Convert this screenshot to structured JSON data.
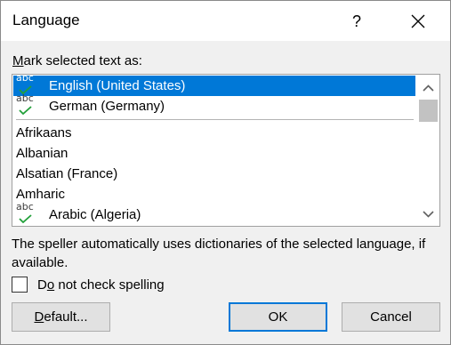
{
  "window": {
    "title": "Language",
    "help_glyph": "?",
    "close_icon": "close-icon"
  },
  "prompt": {
    "prefix_underlined": "M",
    "rest": "ark selected text as:"
  },
  "list": {
    "top_items": [
      {
        "label": "English (United States)",
        "icon": "spellcheck-icon",
        "selected": true
      },
      {
        "label": "German (Germany)",
        "icon": "spellcheck-icon",
        "selected": false
      }
    ],
    "items": [
      {
        "label": "Afrikaans"
      },
      {
        "label": "Albanian"
      },
      {
        "label": "Alsatian (France)"
      },
      {
        "label": "Amharic"
      },
      {
        "label": "Arabic (Algeria)",
        "icon": "spellcheck-icon"
      }
    ],
    "spell_icon_text": "abc"
  },
  "info_text": "The speller automatically uses dictionaries of the selected language, if available.",
  "checkbox": {
    "label_prefix": "D",
    "label_underlined": "o",
    "label_rest": " not check spelling",
    "checked": false
  },
  "buttons": {
    "default_underlined": "D",
    "default_rest": "efault...",
    "ok": "OK",
    "cancel": "Cancel"
  },
  "colors": {
    "selection": "#0078d7",
    "check_green": "#22a03a",
    "dialog_bg": "#f0f0f0"
  }
}
